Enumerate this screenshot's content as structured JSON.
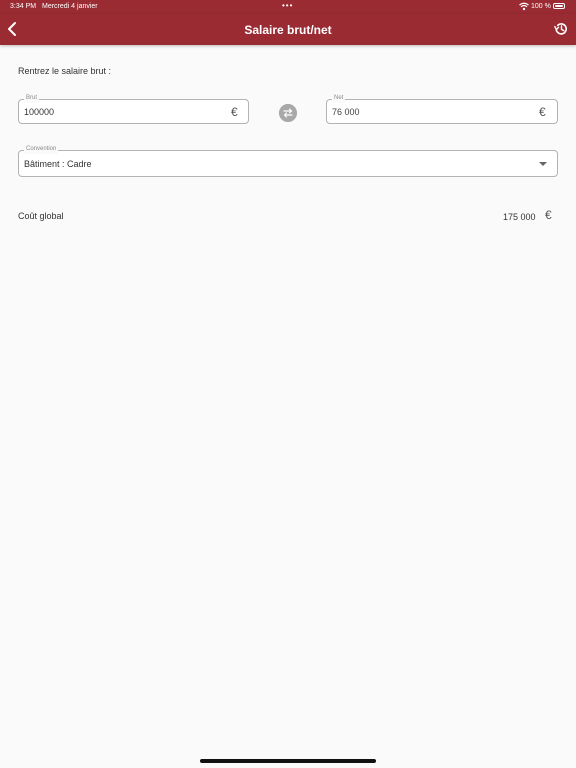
{
  "status_bar": {
    "time": "3:34 PM",
    "date": "Mercredi 4 janvier",
    "dots": "•••",
    "battery_percent": "100 %",
    "battery_level": 1.0
  },
  "header": {
    "title": "Salaire brut/net",
    "background_color": "#9b2b33"
  },
  "form": {
    "prompt": "Rentrez le salaire brut :",
    "brut": {
      "label": "Brut",
      "value": "100000",
      "currency": "€"
    },
    "net": {
      "label": "Net",
      "value": "76 000",
      "currency": "€"
    },
    "convention": {
      "label": "Convention",
      "value": "Bâtiment : Cadre"
    }
  },
  "result": {
    "label": "Coût global",
    "value": "175 000",
    "currency": "€"
  },
  "icons": {
    "back": "chevron-left-icon",
    "history": "history-icon",
    "swap": "swap-arrows-icon",
    "dropdown": "caret-down-icon"
  }
}
